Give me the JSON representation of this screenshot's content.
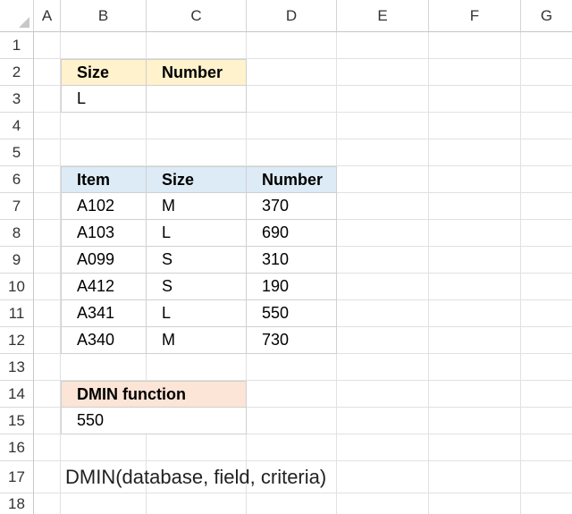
{
  "columns": [
    "A",
    "B",
    "C",
    "D",
    "E",
    "F",
    "G"
  ],
  "rows": [
    "1",
    "2",
    "3",
    "4",
    "5",
    "6",
    "7",
    "8",
    "9",
    "10",
    "11",
    "12",
    "13",
    "14",
    "15",
    "16",
    "17",
    "18"
  ],
  "criteria": {
    "headers": [
      "Size",
      "Number"
    ],
    "values": [
      "L",
      ""
    ]
  },
  "database": {
    "headers": [
      "Item",
      "Size",
      "Number"
    ],
    "rows": [
      [
        "A102",
        "M",
        "370"
      ],
      [
        "A103",
        "L",
        "690"
      ],
      [
        "A099",
        "S",
        "310"
      ],
      [
        "A412",
        "S",
        "190"
      ],
      [
        "A341",
        "L",
        "550"
      ],
      [
        "A340",
        "M",
        "730"
      ]
    ]
  },
  "result": {
    "header": "DMIN function",
    "value": "550"
  },
  "syntax_note": "DMIN(database, field, criteria)"
}
